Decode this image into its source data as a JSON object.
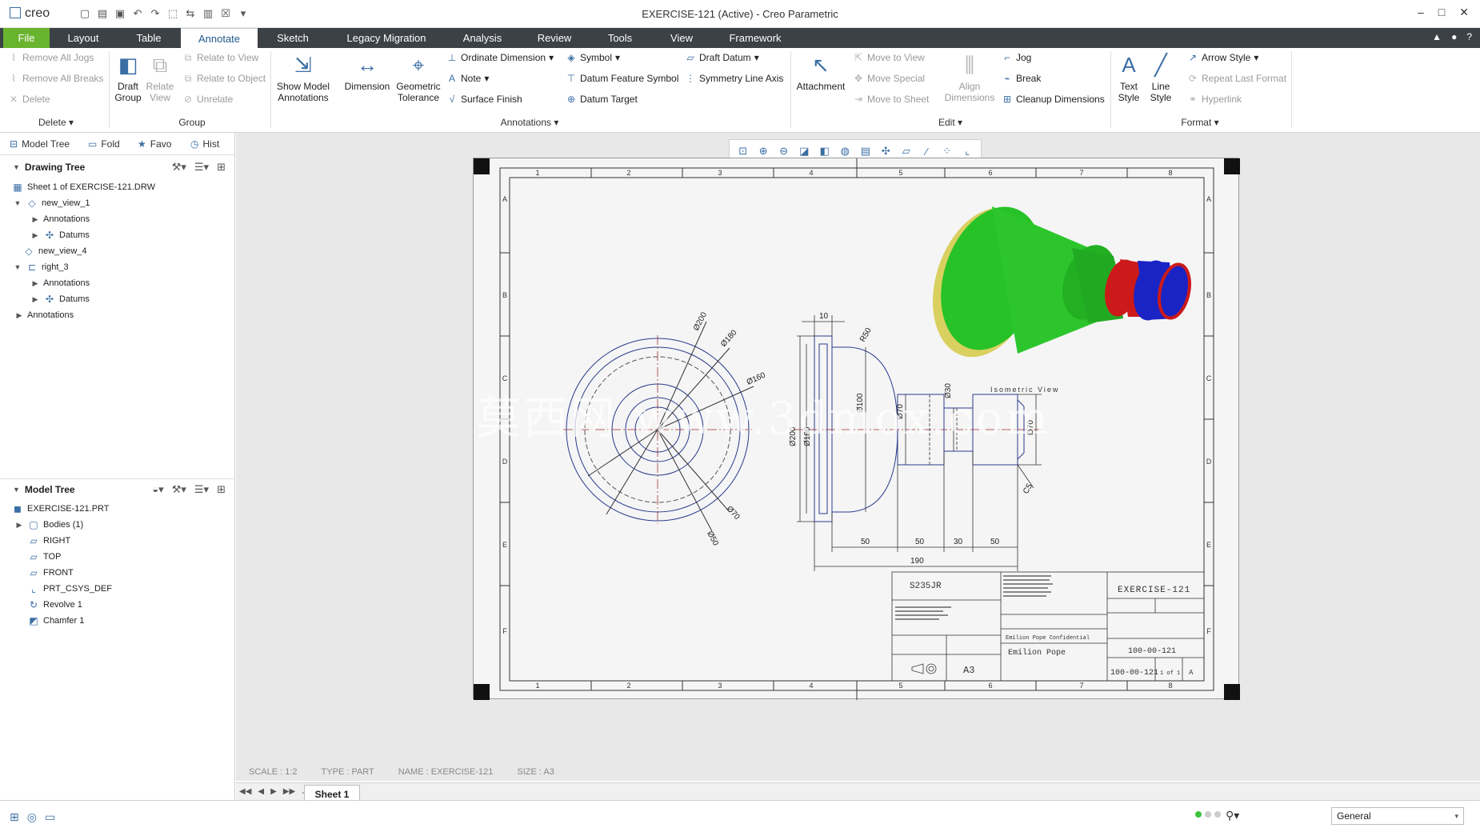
{
  "window": {
    "app_name": "creo",
    "title": "EXERCISE-121 (Active) - Creo Parametric"
  },
  "tabs": [
    "File",
    "Layout",
    "Table",
    "Annotate",
    "Sketch",
    "Legacy Migration",
    "Analysis",
    "Review",
    "Tools",
    "View",
    "Framework"
  ],
  "ribbon": {
    "delete_group": {
      "items": [
        "Remove All Jogs",
        "Remove All Breaks",
        "Delete"
      ],
      "label": "Delete"
    },
    "group_group": {
      "draft_group": "Draft Group",
      "relate_view": "Relate View",
      "items": [
        "Relate to View",
        "Relate to Object",
        "Unrelate"
      ],
      "label": "Group"
    },
    "annotations_group": {
      "show_model": "Show Model Annotations",
      "dimension": "Dimension",
      "geometric_tolerance": "Geometric Tolerance",
      "ordinate": "Ordinate Dimension",
      "note": "Note",
      "surface_finish": "Surface Finish",
      "symbol": "Symbol",
      "datum_feature": "Datum Feature Symbol",
      "datum_target": "Datum Target",
      "draft_datum": "Draft Datum",
      "symmetry": "Symmetry Line Axis",
      "label": "Annotations"
    },
    "edit_group": {
      "attachment": "Attachment",
      "move_to_view": "Move to View",
      "move_special": "Move Special",
      "move_to_sheet": "Move to Sheet",
      "align": "Align Dimensions",
      "jog": "Jog",
      "break": "Break",
      "cleanup": "Cleanup Dimensions",
      "label": "Edit"
    },
    "format_group": {
      "text_style": "Text Style",
      "line_style": "Line Style",
      "arrow_style": "Arrow Style",
      "repeat": "Repeat Last Format",
      "hyperlink": "Hyperlink",
      "label": "Format"
    }
  },
  "left_tabs": [
    "Model Tree",
    "Fold",
    "Favo",
    "Hist"
  ],
  "drawing_tree": {
    "title": "Drawing Tree",
    "items": [
      "Sheet 1 of EXERCISE-121.DRW",
      "new_view_1",
      "Annotations",
      "Datums",
      "new_view_4",
      "right_3",
      "Annotations",
      "Datums",
      "Annotations"
    ]
  },
  "model_tree": {
    "title": "Model Tree",
    "items": [
      "EXERCISE-121.PRT",
      "Bodies (1)",
      "RIGHT",
      "TOP",
      "FRONT",
      "PRT_CSYS_DEF",
      "Revolve 1",
      "Chamfer 1"
    ]
  },
  "drawing": {
    "zone_cols": [
      "1",
      "2",
      "3",
      "4",
      "5",
      "6",
      "7",
      "8"
    ],
    "zone_rows": [
      "A",
      "B",
      "C",
      "D",
      "E",
      "F"
    ],
    "dims_front": [
      "Ø200",
      "Ø180",
      "Ø160",
      "Ø70",
      "Ø50"
    ],
    "dims_side": [
      "10",
      "R50",
      "Ø200",
      "Ø180",
      "Ø100",
      "Ø70",
      "Ø30",
      "Ø70",
      "C5",
      "50",
      "50",
      "30",
      "50",
      "190"
    ],
    "iso_label": "Isometric View",
    "title_block": {
      "material": "S235JR",
      "description": "EXERCISE-121",
      "part_number": "100-00-121",
      "drawing_number": "100-00-121",
      "sheet_size": "A3",
      "confidential": "Emilion Pope Confidential",
      "author": "Emilion Pope",
      "sheet": "1 of 1",
      "revision": "A"
    },
    "watermark": "莫西网 www.3dmox.com"
  },
  "status": {
    "scale": "SCALE : 1:2",
    "type": "TYPE : PART",
    "name": "NAME : EXERCISE-121",
    "size": "SIZE : A3"
  },
  "sheet_tab": "Sheet 1",
  "filter": "General"
}
